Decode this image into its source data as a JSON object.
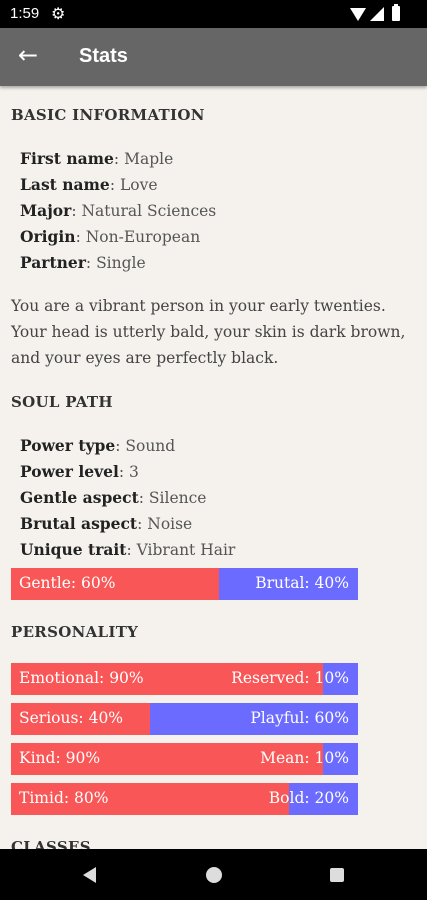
{
  "status_bar": {
    "time": "1:59"
  },
  "app_bar": {
    "back_icon": "arrow-left-icon",
    "title": "Stats"
  },
  "basic": {
    "heading": "BASIC INFORMATION",
    "fields": [
      {
        "label": "First name",
        "value": "Maple"
      },
      {
        "label": "Last name",
        "value": "Love"
      },
      {
        "label": "Major",
        "value": "Natural Sciences"
      },
      {
        "label": "Origin",
        "value": "Non-European"
      },
      {
        "label": "Partner",
        "value": "Single"
      }
    ],
    "description": "You are a vibrant person in your early twenties. Your head is utterly bald, your skin is dark brown, and your eyes are perfectly black."
  },
  "soul": {
    "heading": "SOUL PATH",
    "fields": [
      {
        "label": "Power type",
        "value": "Sound"
      },
      {
        "label": "Power level",
        "value": "3"
      },
      {
        "label": "Gentle aspect",
        "value": "Silence"
      },
      {
        "label": "Brutal aspect",
        "value": "Noise"
      },
      {
        "label": "Unique trait",
        "value": "Vibrant Hair"
      }
    ],
    "bar": {
      "left": "Gentle: 60%",
      "right": "Brutal: 40%",
      "fraction": 0.6
    }
  },
  "personality": {
    "heading": "PERSONALITY",
    "bars": [
      {
        "left": "Emotional: 90%",
        "right": "Reserved: 10%",
        "fraction": 0.9
      },
      {
        "left": "Serious: 40%",
        "right": "Playful: 60%",
        "fraction": 0.4
      },
      {
        "left": "Kind: 90%",
        "right": "Mean: 10%",
        "fraction": 0.9
      },
      {
        "left": "Timid: 80%",
        "right": "Bold: 20%",
        "fraction": 0.8
      }
    ]
  },
  "classes": {
    "heading": "CLASSES"
  },
  "colors": {
    "left_bar": "#f95757",
    "right_bar": "#6b6bff",
    "app_bar": "#666666"
  }
}
